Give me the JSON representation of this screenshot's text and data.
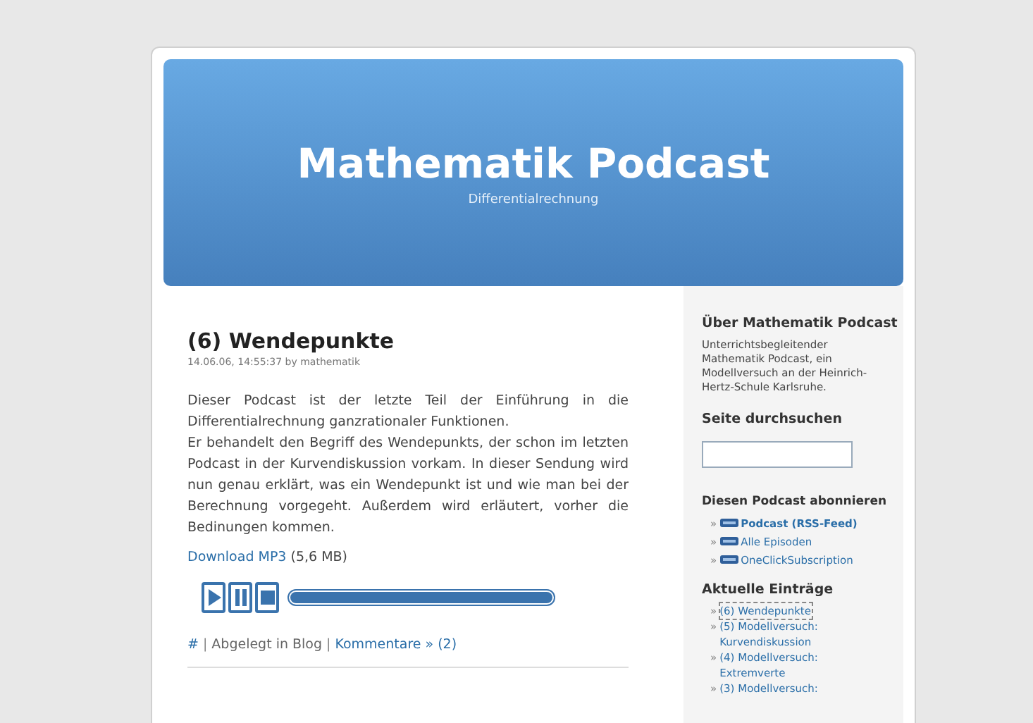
{
  "header": {
    "title": "Mathematik Podcast",
    "subtitle": "Differentialrechnung"
  },
  "post": {
    "title": "(6) Wendepunkte",
    "meta": "14.06.06, 14:55:37 by mathematik",
    "paragraphs": [
      "Dieser Podcast ist der letzte Teil der Einführung in die Differentialrechnung ganzrationaler Funktionen.",
      "Er behandelt den Begriff des Wendepunkts, der schon im letzten Podcast in der Kurvendiskussion vorkam. In dieser Sendung wird nun genau erklärt, was ein Wendepunkt ist und wie man bei der Berechnung vorgegeht. Außerdem wird erläutert, vorher die Bedinungen kommen."
    ],
    "download": {
      "link": "Download MP3",
      "size": "(5,6 MB)"
    },
    "player": {
      "buttons": [
        {
          "kind": "play"
        },
        {
          "kind": "pause"
        },
        {
          "kind": "stop"
        }
      ],
      "level": 1
    },
    "footer": {
      "permalink": "#",
      "sep1": "|",
      "category": "Abgelegt in Blog",
      "sep2": "|",
      "comments": "Kommentare » (2)"
    }
  },
  "sidebar": {
    "about": {
      "heading": "Über Mathematik Podcast",
      "text": "Unterrichtsbegleitender Mathematik Podcast, ein Modellversuch an der Heinrich-Hertz-Schule Karlsruhe."
    },
    "search": {
      "heading": "Seite durchsuchen"
    },
    "subscribe": {
      "heading": "Diesen Podcast abonnieren",
      "items": [
        {
          "bullet": "»",
          "label": "Podcast (RSS-Feed)",
          "bold": true
        },
        {
          "bullet": "»",
          "label": "Alle Episoden",
          "bold": false
        },
        {
          "bullet": "»",
          "label": "OneClickSubscription",
          "bold": false
        }
      ]
    },
    "recent": {
      "heading": "Aktuelle Einträge",
      "items": [
        {
          "bullet": "»",
          "label": "(6) Wendepunkte",
          "selected": true
        },
        {
          "bullet": "»",
          "label": "(5) Modellversuch: Kurvendiskussion",
          "selected": false
        },
        {
          "bullet": "»",
          "label": "(4) Modellversuch: Extremverte",
          "selected": false
        },
        {
          "bullet": "»",
          "label": "(3) Modellversuch:",
          "selected": false
        }
      ]
    }
  }
}
